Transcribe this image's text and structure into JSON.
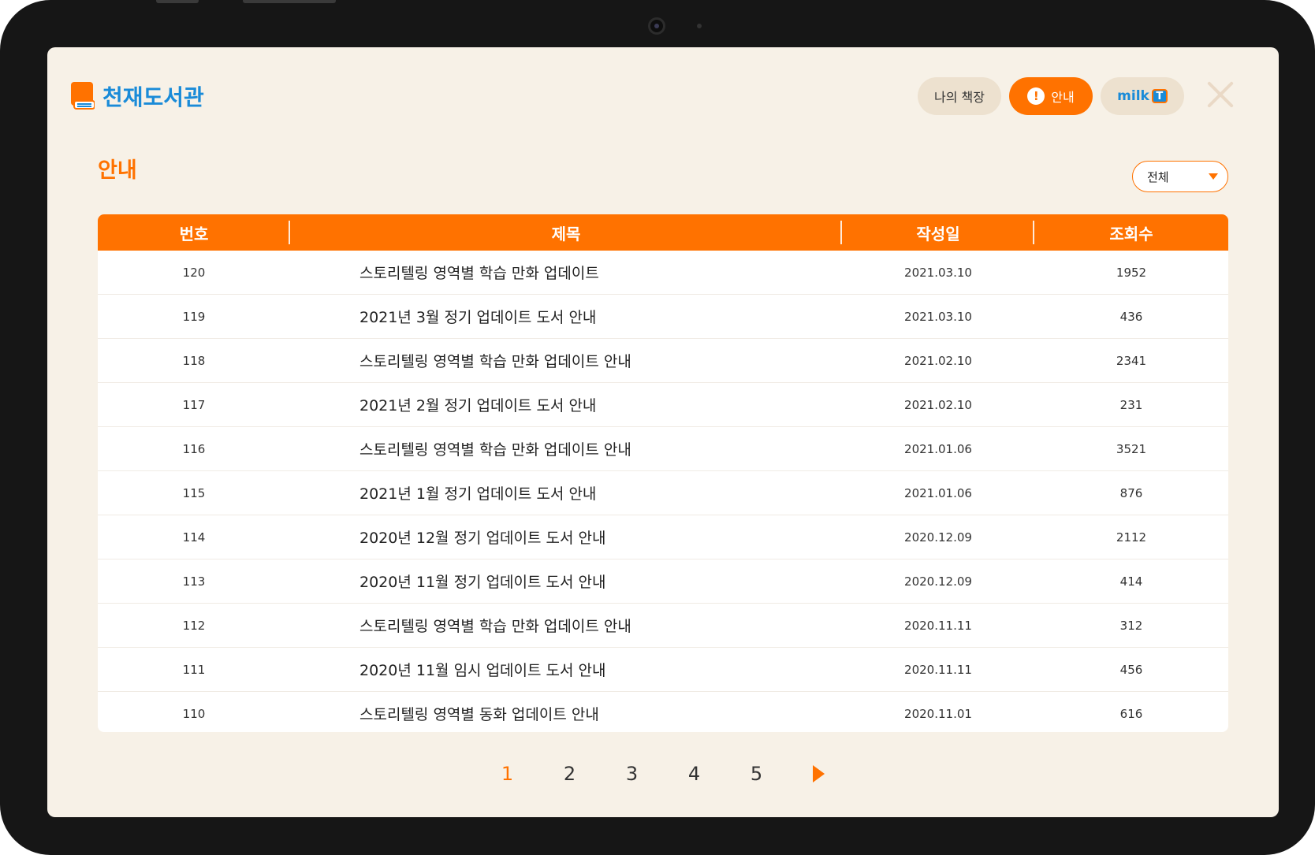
{
  "app": {
    "title": "천재도서관"
  },
  "header": {
    "my_shelf_label": "나의 책장",
    "notice_label": "안내",
    "notice_icon": "!",
    "milk_word": "milk",
    "milk_t": "T"
  },
  "page": {
    "title": "안내",
    "filter_selected": "전체"
  },
  "table": {
    "columns": [
      "번호",
      "제목",
      "작성일",
      "조회수"
    ],
    "rows": [
      {
        "num": "120",
        "title": "스토리텔링 영역별 학습 만화 업데이트",
        "date": "2021.03.10",
        "views": "1952"
      },
      {
        "num": "119",
        "title": "2021년 3월 정기 업데이트 도서 안내",
        "date": "2021.03.10",
        "views": "436"
      },
      {
        "num": "118",
        "title": "스토리텔링 영역별 학습 만화 업데이트 안내",
        "date": "2021.02.10",
        "views": "2341"
      },
      {
        "num": "117",
        "title": "2021년 2월 정기 업데이트 도서 안내",
        "date": "2021.02.10",
        "views": "231"
      },
      {
        "num": "116",
        "title": "스토리텔링 영역별 학습 만화 업데이트 안내",
        "date": "2021.01.06",
        "views": "3521"
      },
      {
        "num": "115",
        "title": "2021년 1월 정기 업데이트 도서 안내",
        "date": "2021.01.06",
        "views": "876"
      },
      {
        "num": "114",
        "title": "2020년 12월 정기 업데이트 도서 안내",
        "date": "2020.12.09",
        "views": "2112"
      },
      {
        "num": "113",
        "title": "2020년 11월 정기 업데이트 도서 안내",
        "date": "2020.12.09",
        "views": "414"
      },
      {
        "num": "112",
        "title": "스토리텔링 영역별 학습 만화 업데이트 안내",
        "date": "2020.11.11",
        "views": "312"
      },
      {
        "num": "111",
        "title": "2020년 11월 임시 업데이트 도서 안내",
        "date": "2020.11.11",
        "views": "456"
      },
      {
        "num": "110",
        "title": "스토리텔링 영역별 동화 업데이트 안내",
        "date": "2020.11.01",
        "views": "616"
      }
    ]
  },
  "pagination": {
    "pages": [
      "1",
      "2",
      "3",
      "4",
      "5"
    ],
    "current": "1"
  },
  "colors": {
    "accent": "#ff7200",
    "brand_blue": "#1a8bd8",
    "background": "#f7f1e7"
  }
}
